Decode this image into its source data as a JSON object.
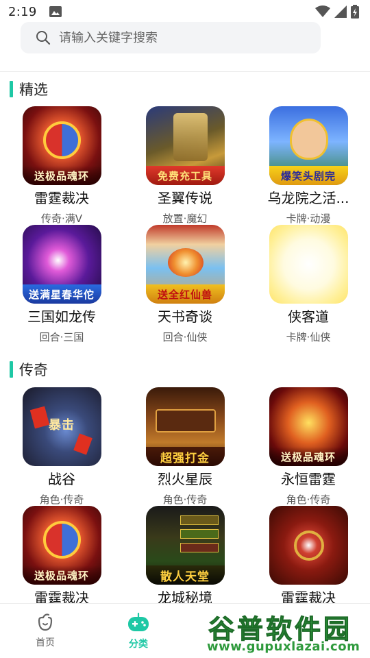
{
  "status_bar": {
    "time": "2:19"
  },
  "search": {
    "placeholder": "请输入关键字搜索"
  },
  "sections": [
    {
      "title": "精选",
      "games": [
        {
          "name": "雷霆裁决",
          "tags": "传奇·满V",
          "icon_text": "送极品魂环"
        },
        {
          "name": "圣翼传说",
          "tags": "放置·魔幻",
          "icon_text": "免费充工具"
        },
        {
          "name": "乌龙院之活...",
          "tags": "卡牌·动漫",
          "icon_text": "爆笑头剧完"
        },
        {
          "name": "三国如龙传",
          "tags": "回合·三国",
          "icon_text": "送满星春华佗"
        },
        {
          "name": "天书奇谈",
          "tags": "回合·仙侠",
          "icon_text": "送全红仙兽"
        },
        {
          "name": "侠客道",
          "tags": "卡牌·仙侠",
          "icon_text": ""
        }
      ]
    },
    {
      "title": "传奇",
      "games": [
        {
          "name": "战谷",
          "tags": "角色·传奇",
          "icon_text": "暴击"
        },
        {
          "name": "烈火星辰",
          "tags": "角色·传奇",
          "icon_text": "超强打金"
        },
        {
          "name": "永恒雷霆",
          "tags": "角色·传奇",
          "icon_text": "送极品魂环"
        },
        {
          "name": "雷霆裁决",
          "tags": "",
          "icon_text": "送极品魂环"
        },
        {
          "name": "龙城秘境",
          "tags": "",
          "icon_text": "散人天堂"
        },
        {
          "name": "雷霆裁决",
          "tags": "",
          "icon_text": ""
        }
      ]
    }
  ],
  "bottom_nav": [
    {
      "label": "首页",
      "icon": "home-bag-icon",
      "active": false
    },
    {
      "label": "分类",
      "icon": "gamepad-icon",
      "active": true
    }
  ],
  "watermark": {
    "title": "谷普软件园",
    "url": "www.gupuxlazai.com"
  },
  "colors": {
    "accent": "#1ec8a5",
    "nav_inactive": "#666666",
    "text": "#111111"
  }
}
